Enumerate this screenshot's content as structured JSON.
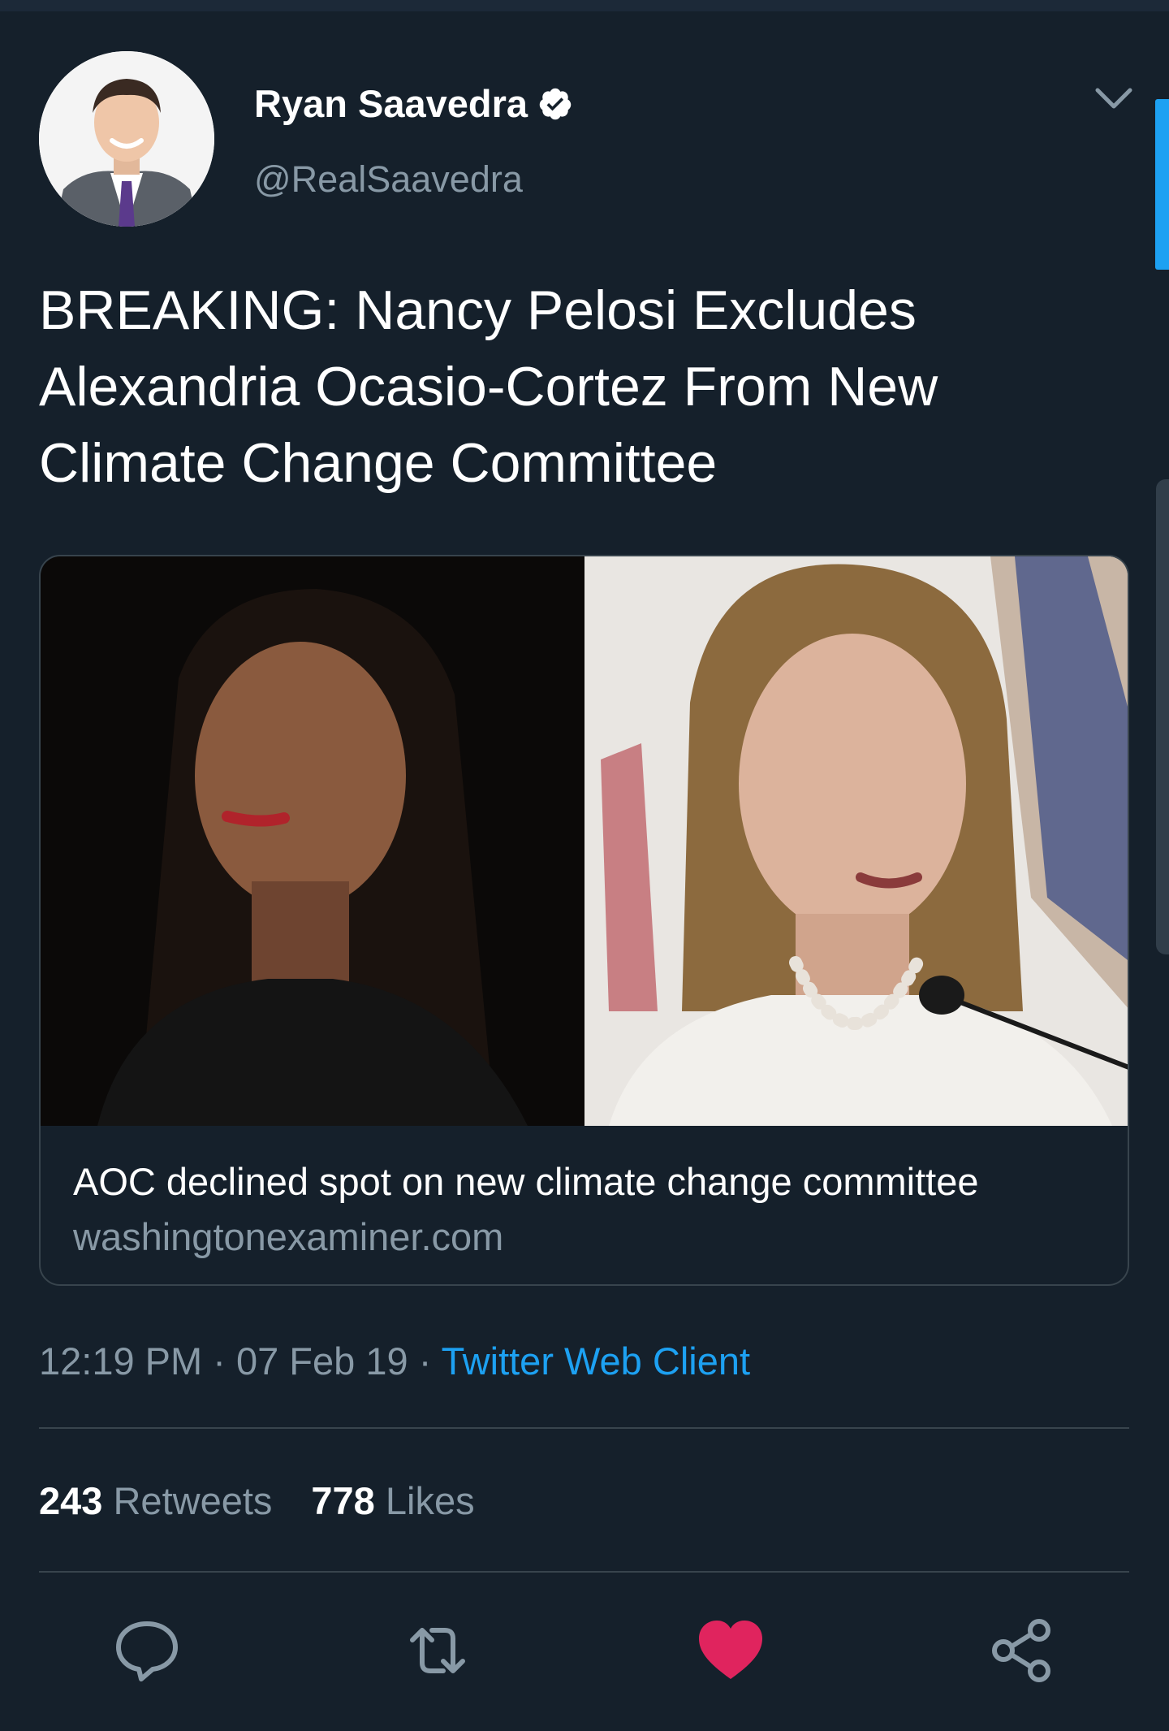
{
  "author": {
    "name": "Ryan Saavedra",
    "handle": "@RealSaavedra",
    "verified": true
  },
  "tweet": {
    "text": "BREAKING: Nancy Pelosi Excludes Alexandria Ocasio-Cortez From New Climate Change Committee"
  },
  "link_card": {
    "title": "AOC declined spot on new climate change committee",
    "domain": "washingtonexaminer.com"
  },
  "meta": {
    "time": "12:19 PM",
    "date": "07 Feb 19",
    "separator": " · ",
    "client": "Twitter Web Client"
  },
  "stats": {
    "retweets_count": "243",
    "retweets_label": "Retweets",
    "likes_count": "778",
    "likes_label": "Likes"
  },
  "actions": [
    {
      "icon": "reply-icon"
    },
    {
      "icon": "retweet-icon"
    },
    {
      "icon": "heart-icon",
      "active": true
    },
    {
      "icon": "share-icon"
    }
  ],
  "colors": {
    "background": "#15202b",
    "accent": "#1da1f2",
    "secondary_text": "#8899a6",
    "like_active": "#e0245e",
    "border": "#38444d"
  }
}
